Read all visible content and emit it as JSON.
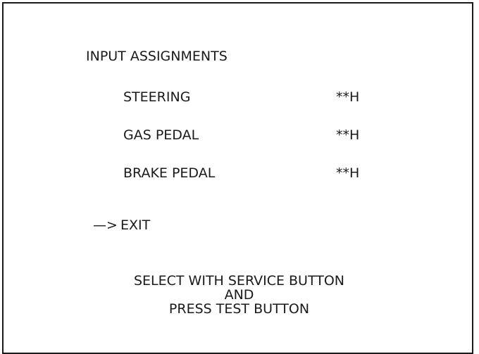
{
  "screen": {
    "title": "INPUT ASSIGNMENTS",
    "items": [
      {
        "label": "STEERING",
        "value": "**H"
      },
      {
        "label": "GAS PEDAL",
        "value": "**H"
      },
      {
        "label": "BRAKE PEDAL",
        "value": "**H"
      }
    ],
    "cursor": "—>",
    "exit_label": "EXIT",
    "instructions": [
      "SELECT WITH SERVICE BUTTON",
      "AND",
      "PRESS TEST BUTTON"
    ]
  }
}
